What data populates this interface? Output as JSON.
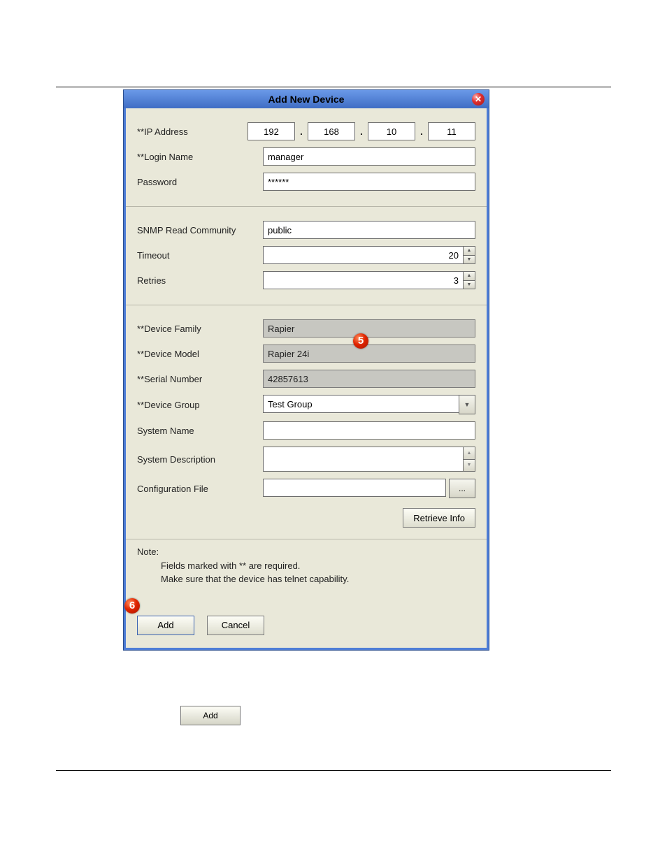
{
  "dialog": {
    "title": "Add New Device",
    "close_icon": "✕"
  },
  "section1": {
    "ip_label": "**IP Address",
    "ip": {
      "o1": "192",
      "o2": "168",
      "o3": "10",
      "o4": "11"
    },
    "login_label": "**Login Name",
    "login_value": "manager",
    "password_label": "Password",
    "password_value": "******"
  },
  "section2": {
    "snmp_label": "SNMP Read Community",
    "snmp_value": "public",
    "timeout_label": "Timeout",
    "timeout_value": "20",
    "retries_label": "Retries",
    "retries_value": "3"
  },
  "section3": {
    "family_label": "**Device Family",
    "family_value": "Rapier",
    "model_label": "**Device Model",
    "model_value": "Rapier 24i",
    "serial_label": "**Serial Number",
    "serial_value": "42857613",
    "group_label": "**Device Group",
    "group_value": "Test Group",
    "sysname_label": "System Name",
    "sysname_value": "",
    "sysdesc_label": "System Description",
    "sysdesc_value": "",
    "config_label": "Configuration File",
    "config_value": "",
    "browse_label": "...",
    "retrieve_label": "Retrieve Info"
  },
  "note": {
    "heading": "Note:",
    "line1": "Fields marked with ** are required.",
    "line2": "Make sure that the device has telnet capability.",
    "add_label": "Add",
    "cancel_label": "Cancel"
  },
  "callouts": {
    "five": "5",
    "six": "6"
  },
  "inline_add": "Add"
}
